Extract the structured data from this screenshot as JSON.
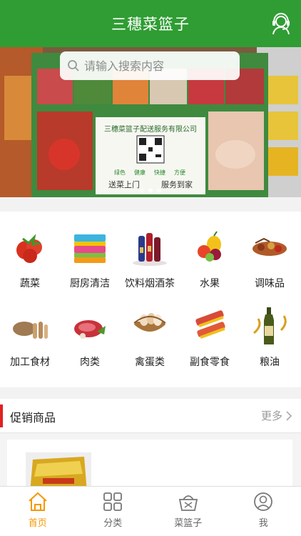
{
  "header": {
    "title": "三穗菜篮子",
    "service_icon": "customer-service-icon"
  },
  "search": {
    "placeholder": "请输入搜索内容"
  },
  "banner": {
    "company": "三穗菜篮子配送服务有限公司",
    "tags": [
      "绿色",
      "健康",
      "快捷",
      "方便"
    ],
    "slogan_left": "送菜上门",
    "slogan_right": "服务到家",
    "dots": 3,
    "active_dot": 1
  },
  "categories": [
    {
      "label": "蔬菜",
      "icon": "vegetables-icon"
    },
    {
      "label": "厨房清洁",
      "icon": "sponge-icon"
    },
    {
      "label": "饮料烟酒茶",
      "icon": "drinks-icon"
    },
    {
      "label": "水果",
      "icon": "fruit-icon"
    },
    {
      "label": "调味品",
      "icon": "spices-icon"
    },
    {
      "label": "加工食材",
      "icon": "processed-food-icon"
    },
    {
      "label": "肉类",
      "icon": "meat-icon"
    },
    {
      "label": "禽蛋类",
      "icon": "eggs-icon"
    },
    {
      "label": "副食零食",
      "icon": "snacks-icon"
    },
    {
      "label": "粮油",
      "icon": "oil-icon"
    }
  ],
  "promo": {
    "title": "促销商品",
    "more": "更多"
  },
  "tabbar": [
    {
      "label": "首页",
      "icon": "home-icon",
      "active": true
    },
    {
      "label": "分类",
      "icon": "grid-icon",
      "active": false
    },
    {
      "label": "菜篮子",
      "icon": "basket-icon",
      "active": false
    },
    {
      "label": "我",
      "icon": "user-icon",
      "active": false
    }
  ],
  "colors": {
    "brand_green": "#2f9d33",
    "accent_orange": "#f39800",
    "promo_red": "#e02020"
  }
}
